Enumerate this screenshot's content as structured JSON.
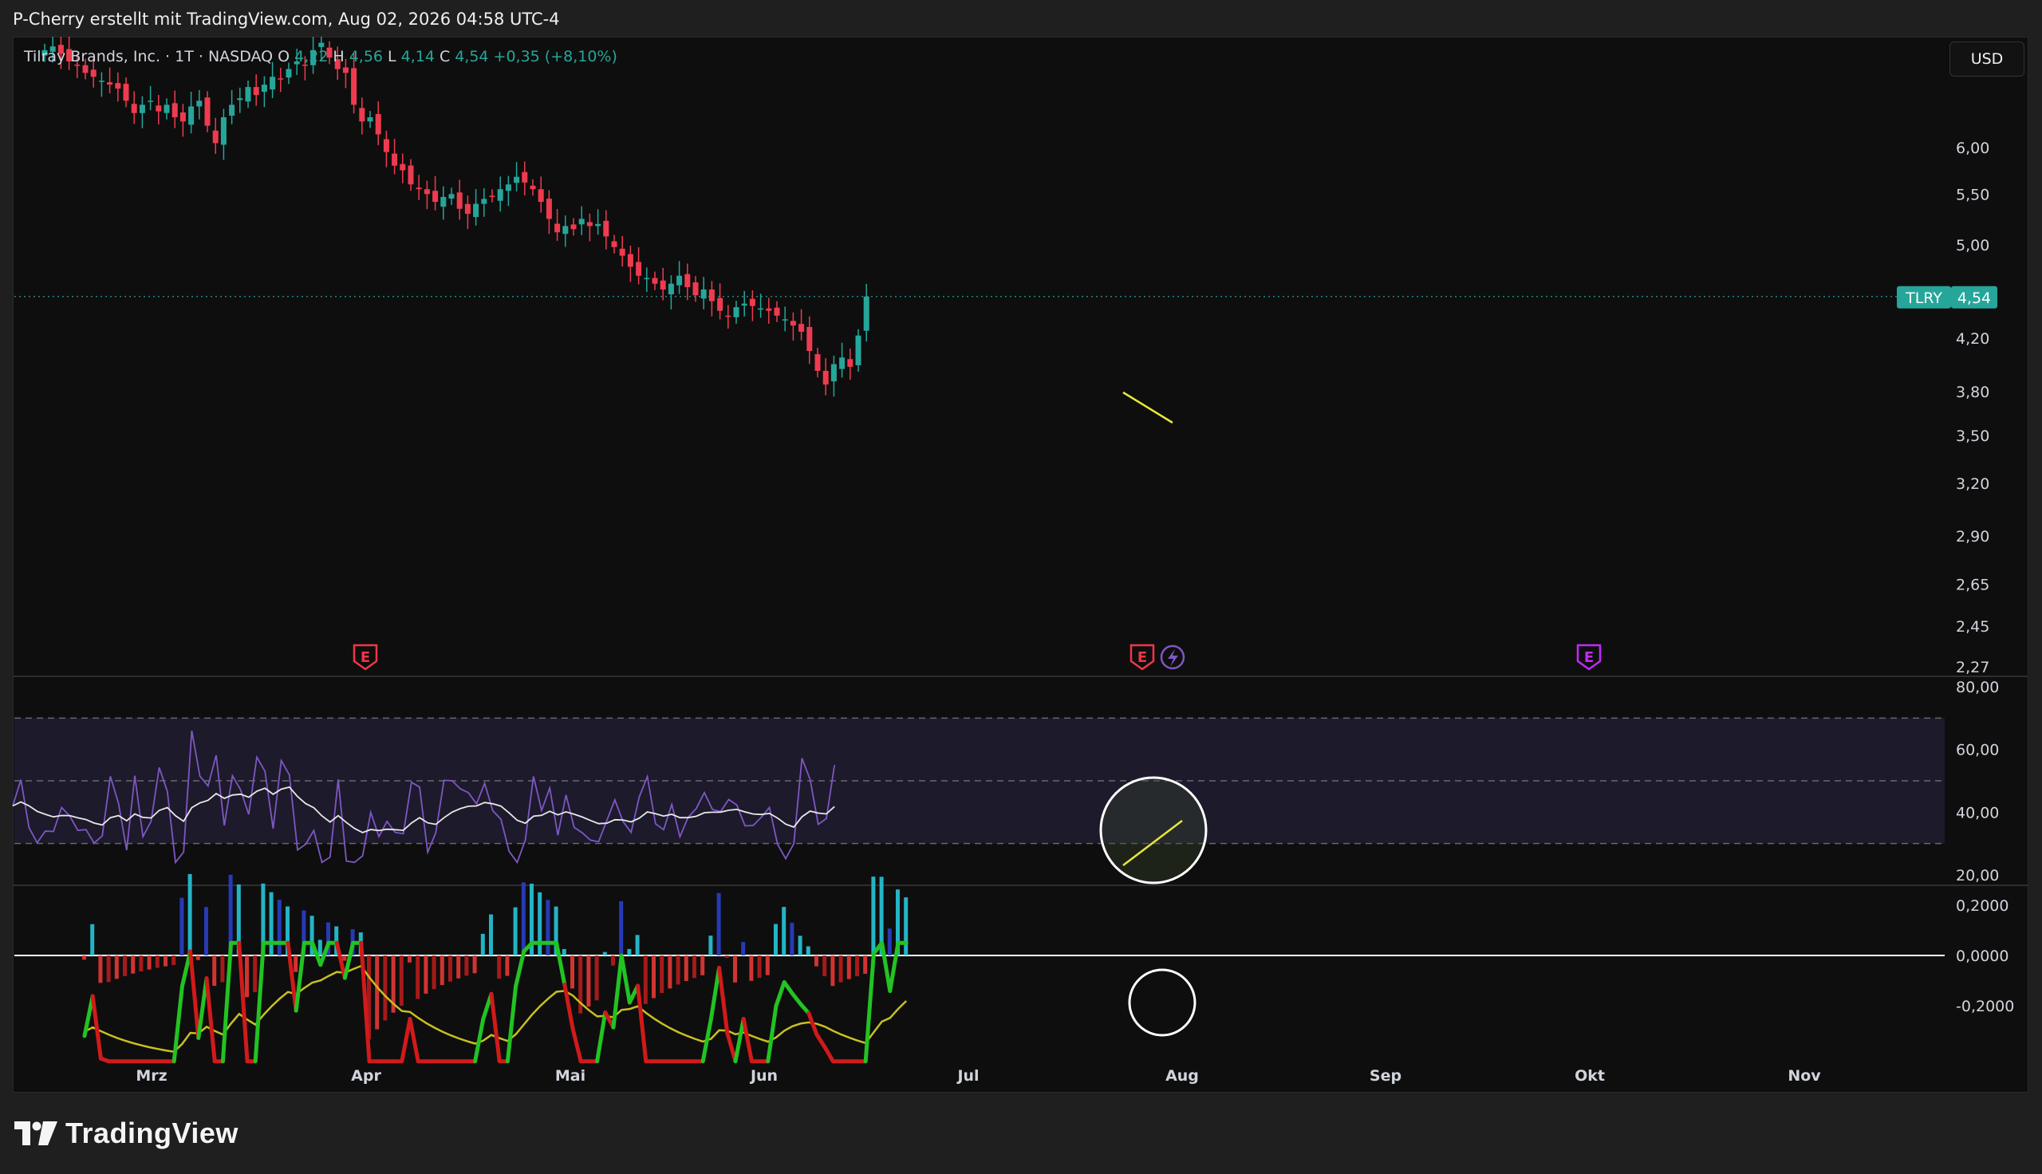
{
  "header": {
    "attribution": "P-Cherry erstellt mit TradingView.com, Aug 02, 2026 04:58 UTC-4"
  },
  "legend": {
    "symbol_name": "Tilray Brands, Inc. · 1T · NASDAQ",
    "o_key": "O",
    "o_val": "4,22",
    "h_key": "H",
    "h_val": "4,56",
    "l_key": "L",
    "l_val": "4,14",
    "c_key": "C",
    "c_val": "4,54",
    "change": "+0,35 (+8,10%)"
  },
  "currency_button": "USD",
  "price_tag": {
    "symbol": "TLRY",
    "price": "4,54"
  },
  "branding": "TradingView",
  "colors": {
    "up": "#26a69a",
    "down": "#ef3b4f",
    "rsi_line": "#7e57c2",
    "rsi_ma": "#e8e8e8",
    "macd_up": "#22c322",
    "macd_down": "#d11a1a",
    "signal": "#c8c020",
    "annotation": "#e8e83a",
    "earnings": "#f23645",
    "dividend": "#c428ff"
  },
  "chart_data": [
    {
      "type": "candlestick",
      "title": "Tilray Brands, Inc. · 1T · NASDAQ",
      "x_axis": [
        "Mrz",
        "Apr",
        "Mai",
        "Jun",
        "Jul",
        "Aug",
        "Sep",
        "Okt",
        "Nov"
      ],
      "y_ticks": [
        "6,00",
        "5,50",
        "5,00",
        "4,20",
        "3,80",
        "3,50",
        "3,20",
        "2,90",
        "2,65",
        "2,45",
        "2,27"
      ],
      "y_scale": "log",
      "ylim": [
        2.27,
        7.6
      ],
      "last_close": 4.54,
      "closes": [
        7.2,
        7.25,
        7.15,
        7.05,
        7.0,
        6.9,
        6.85,
        6.8,
        6.75,
        6.7,
        6.55,
        6.4,
        6.5,
        6.55,
        6.42,
        6.5,
        6.35,
        6.3,
        6.48,
        6.55,
        6.25,
        6.05,
        6.35,
        6.5,
        6.58,
        6.72,
        6.62,
        6.75,
        6.85,
        6.82,
        6.95,
        7.05,
        7.0,
        7.2,
        7.3,
        7.1,
        6.95,
        6.9,
        6.5,
        6.3,
        6.35,
        6.15,
        5.95,
        5.8,
        5.75,
        5.6,
        5.55,
        5.5,
        5.42,
        5.47,
        5.5,
        5.35,
        5.3,
        5.4,
        5.45,
        5.48,
        5.55,
        5.6,
        5.68,
        5.62,
        5.55,
        5.42,
        5.25,
        5.12,
        5.18,
        5.15,
        5.25,
        5.18,
        5.2,
        5.08,
        4.98,
        4.9,
        4.8,
        4.72,
        4.7,
        4.65,
        4.6,
        4.65,
        4.72,
        4.62,
        4.55,
        4.6,
        4.5,
        4.42,
        4.38,
        4.45,
        4.48,
        4.46,
        4.44,
        4.42,
        4.38,
        4.35,
        4.3,
        4.25,
        4.1,
        3.95,
        3.85,
        4.0,
        4.05,
        3.98,
        4.22,
        4.54
      ],
      "series": [
        {
          "name": "RSI",
          "ylim": [
            20,
            80
          ],
          "y_ticks": [
            "80,00",
            "60,00",
            "40,00",
            "20,00"
          ],
          "bands": [
            30,
            50,
            70
          ]
        },
        {
          "name": "MACD",
          "y_ticks": [
            "0,2000",
            "0,0000",
            "-0,2000"
          ]
        }
      ],
      "annotations": [
        "Abwärtstrendlinie Preis-Tief",
        "Aufwärtstrendlinie RSI",
        "Kreis RSI",
        "Kreis MACD"
      ]
    }
  ]
}
